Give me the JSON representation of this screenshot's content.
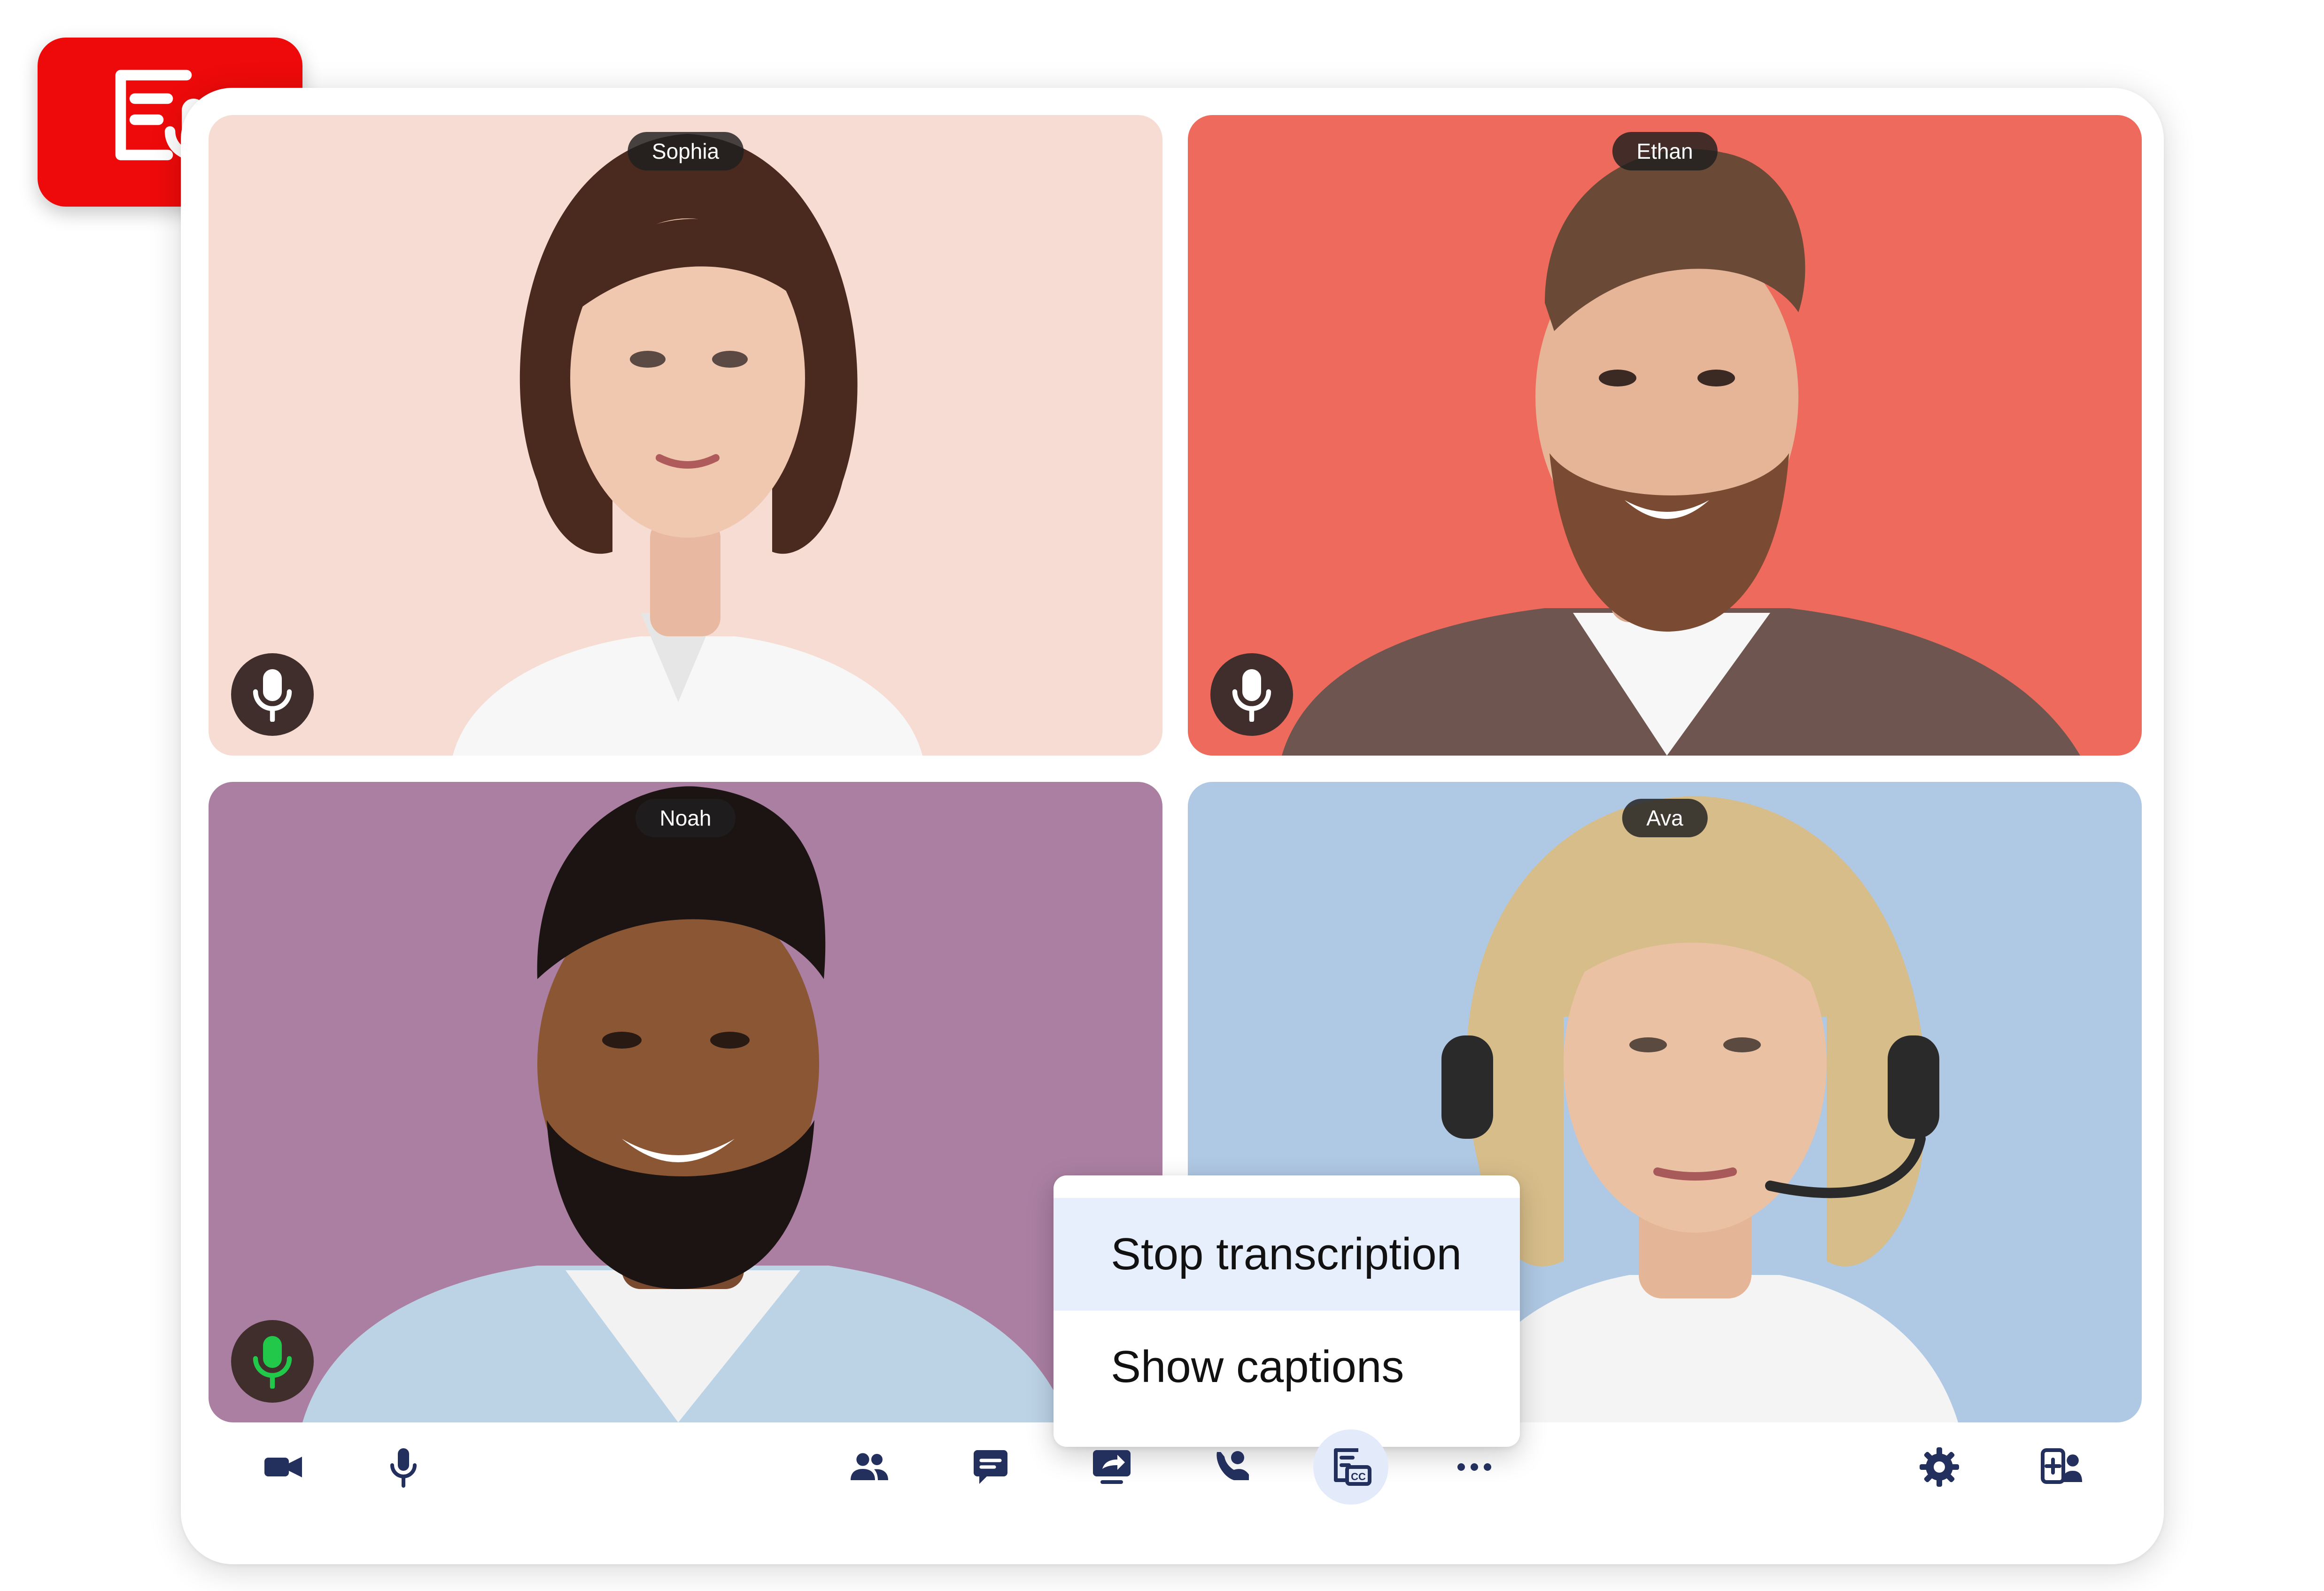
{
  "transcription_badge": {
    "icon": "transcript-mic-icon",
    "color": "#ee0a0a"
  },
  "participants": [
    {
      "name": "Sophia",
      "background": "#f6dcd3",
      "mic_state": "idle"
    },
    {
      "name": "Ethan",
      "background": "#ee6a5c",
      "mic_state": "idle"
    },
    {
      "name": "Noah",
      "background": "#ab7fa2",
      "mic_state": "speaking"
    },
    {
      "name": "Ava",
      "background": "#afc8e3",
      "mic_state": "idle"
    }
  ],
  "menu": {
    "items": [
      {
        "label": "Stop transcription",
        "highlighted": true
      },
      {
        "label": "Show captions",
        "highlighted": false
      }
    ]
  },
  "toolbar": {
    "left": [
      "video-camera-icon",
      "microphone-icon"
    ],
    "center": [
      "participants-icon",
      "chat-icon",
      "share-screen-icon",
      "phone-person-icon",
      "transcription-captions-icon",
      "more-options-icon"
    ],
    "right": [
      "settings-icon",
      "add-participant-icon"
    ],
    "active": "transcription-captions-icon",
    "icon_color": "#23305e",
    "speaking_color": "#22c84a"
  }
}
